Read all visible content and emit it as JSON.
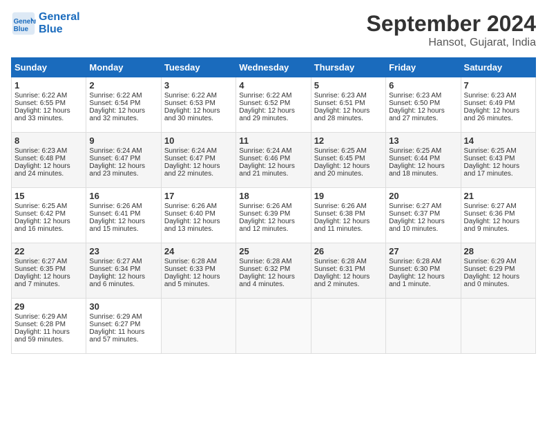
{
  "header": {
    "logo_line1": "General",
    "logo_line2": "Blue",
    "month": "September 2024",
    "location": "Hansot, Gujarat, India"
  },
  "days_of_week": [
    "Sunday",
    "Monday",
    "Tuesday",
    "Wednesday",
    "Thursday",
    "Friday",
    "Saturday"
  ],
  "weeks": [
    [
      {
        "day": "1",
        "lines": [
          "Sunrise: 6:22 AM",
          "Sunset: 6:55 PM",
          "Daylight: 12 hours",
          "and 33 minutes."
        ]
      },
      {
        "day": "2",
        "lines": [
          "Sunrise: 6:22 AM",
          "Sunset: 6:54 PM",
          "Daylight: 12 hours",
          "and 32 minutes."
        ]
      },
      {
        "day": "3",
        "lines": [
          "Sunrise: 6:22 AM",
          "Sunset: 6:53 PM",
          "Daylight: 12 hours",
          "and 30 minutes."
        ]
      },
      {
        "day": "4",
        "lines": [
          "Sunrise: 6:22 AM",
          "Sunset: 6:52 PM",
          "Daylight: 12 hours",
          "and 29 minutes."
        ]
      },
      {
        "day": "5",
        "lines": [
          "Sunrise: 6:23 AM",
          "Sunset: 6:51 PM",
          "Daylight: 12 hours",
          "and 28 minutes."
        ]
      },
      {
        "day": "6",
        "lines": [
          "Sunrise: 6:23 AM",
          "Sunset: 6:50 PM",
          "Daylight: 12 hours",
          "and 27 minutes."
        ]
      },
      {
        "day": "7",
        "lines": [
          "Sunrise: 6:23 AM",
          "Sunset: 6:49 PM",
          "Daylight: 12 hours",
          "and 26 minutes."
        ]
      }
    ],
    [
      {
        "day": "8",
        "lines": [
          "Sunrise: 6:23 AM",
          "Sunset: 6:48 PM",
          "Daylight: 12 hours",
          "and 24 minutes."
        ]
      },
      {
        "day": "9",
        "lines": [
          "Sunrise: 6:24 AM",
          "Sunset: 6:47 PM",
          "Daylight: 12 hours",
          "and 23 minutes."
        ]
      },
      {
        "day": "10",
        "lines": [
          "Sunrise: 6:24 AM",
          "Sunset: 6:47 PM",
          "Daylight: 12 hours",
          "and 22 minutes."
        ]
      },
      {
        "day": "11",
        "lines": [
          "Sunrise: 6:24 AM",
          "Sunset: 6:46 PM",
          "Daylight: 12 hours",
          "and 21 minutes."
        ]
      },
      {
        "day": "12",
        "lines": [
          "Sunrise: 6:25 AM",
          "Sunset: 6:45 PM",
          "Daylight: 12 hours",
          "and 20 minutes."
        ]
      },
      {
        "day": "13",
        "lines": [
          "Sunrise: 6:25 AM",
          "Sunset: 6:44 PM",
          "Daylight: 12 hours",
          "and 18 minutes."
        ]
      },
      {
        "day": "14",
        "lines": [
          "Sunrise: 6:25 AM",
          "Sunset: 6:43 PM",
          "Daylight: 12 hours",
          "and 17 minutes."
        ]
      }
    ],
    [
      {
        "day": "15",
        "lines": [
          "Sunrise: 6:25 AM",
          "Sunset: 6:42 PM",
          "Daylight: 12 hours",
          "and 16 minutes."
        ]
      },
      {
        "day": "16",
        "lines": [
          "Sunrise: 6:26 AM",
          "Sunset: 6:41 PM",
          "Daylight: 12 hours",
          "and 15 minutes."
        ]
      },
      {
        "day": "17",
        "lines": [
          "Sunrise: 6:26 AM",
          "Sunset: 6:40 PM",
          "Daylight: 12 hours",
          "and 13 minutes."
        ]
      },
      {
        "day": "18",
        "lines": [
          "Sunrise: 6:26 AM",
          "Sunset: 6:39 PM",
          "Daylight: 12 hours",
          "and 12 minutes."
        ]
      },
      {
        "day": "19",
        "lines": [
          "Sunrise: 6:26 AM",
          "Sunset: 6:38 PM",
          "Daylight: 12 hours",
          "and 11 minutes."
        ]
      },
      {
        "day": "20",
        "lines": [
          "Sunrise: 6:27 AM",
          "Sunset: 6:37 PM",
          "Daylight: 12 hours",
          "and 10 minutes."
        ]
      },
      {
        "day": "21",
        "lines": [
          "Sunrise: 6:27 AM",
          "Sunset: 6:36 PM",
          "Daylight: 12 hours",
          "and 9 minutes."
        ]
      }
    ],
    [
      {
        "day": "22",
        "lines": [
          "Sunrise: 6:27 AM",
          "Sunset: 6:35 PM",
          "Daylight: 12 hours",
          "and 7 minutes."
        ]
      },
      {
        "day": "23",
        "lines": [
          "Sunrise: 6:27 AM",
          "Sunset: 6:34 PM",
          "Daylight: 12 hours",
          "and 6 minutes."
        ]
      },
      {
        "day": "24",
        "lines": [
          "Sunrise: 6:28 AM",
          "Sunset: 6:33 PM",
          "Daylight: 12 hours",
          "and 5 minutes."
        ]
      },
      {
        "day": "25",
        "lines": [
          "Sunrise: 6:28 AM",
          "Sunset: 6:32 PM",
          "Daylight: 12 hours",
          "and 4 minutes."
        ]
      },
      {
        "day": "26",
        "lines": [
          "Sunrise: 6:28 AM",
          "Sunset: 6:31 PM",
          "Daylight: 12 hours",
          "and 2 minutes."
        ]
      },
      {
        "day": "27",
        "lines": [
          "Sunrise: 6:28 AM",
          "Sunset: 6:30 PM",
          "Daylight: 12 hours",
          "and 1 minute."
        ]
      },
      {
        "day": "28",
        "lines": [
          "Sunrise: 6:29 AM",
          "Sunset: 6:29 PM",
          "Daylight: 12 hours",
          "and 0 minutes."
        ]
      }
    ],
    [
      {
        "day": "29",
        "lines": [
          "Sunrise: 6:29 AM",
          "Sunset: 6:28 PM",
          "Daylight: 11 hours",
          "and 59 minutes."
        ]
      },
      {
        "day": "30",
        "lines": [
          "Sunrise: 6:29 AM",
          "Sunset: 6:27 PM",
          "Daylight: 11 hours",
          "and 57 minutes."
        ]
      },
      null,
      null,
      null,
      null,
      null
    ]
  ]
}
